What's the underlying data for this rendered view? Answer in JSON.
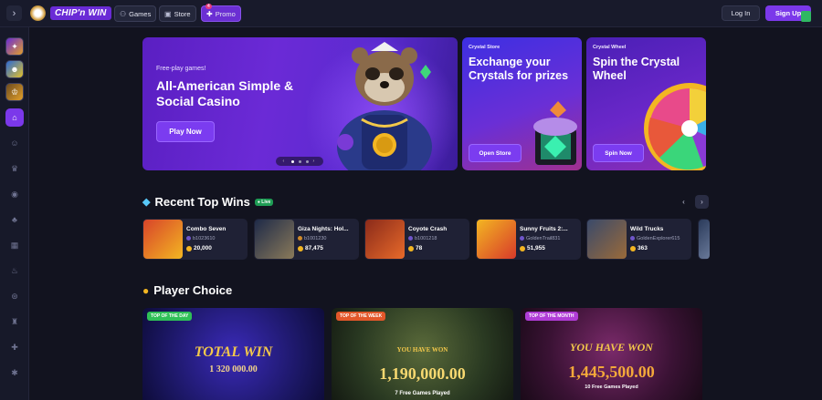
{
  "header": {
    "logo_text": "CHIP'n WIN",
    "nav": [
      {
        "label": "Games",
        "icon": "joystick-icon"
      },
      {
        "label": "Store",
        "icon": "store-icon"
      },
      {
        "label": "Promo",
        "icon": "gift-icon",
        "badge": "4"
      }
    ],
    "login_label": "Log In",
    "signup_label": "Sign Up"
  },
  "sidebar": {
    "items": [
      {
        "name": "slots-game-tile",
        "icon": "🎰"
      },
      {
        "name": "trophy-game-tile",
        "icon": "🏆"
      },
      {
        "name": "tournament-tile",
        "icon": "🏅"
      },
      {
        "name": "home",
        "icon": "⌂"
      },
      {
        "name": "users",
        "icon": "☺"
      },
      {
        "name": "crown",
        "icon": "♛"
      },
      {
        "name": "slots",
        "icon": "◉"
      },
      {
        "name": "cherries",
        "icon": "♣"
      },
      {
        "name": "table-games",
        "icon": "▦"
      },
      {
        "name": "fire",
        "icon": "♨"
      },
      {
        "name": "chip",
        "icon": "⊛"
      },
      {
        "name": "castle",
        "icon": "♜"
      },
      {
        "name": "gift",
        "icon": "✚"
      },
      {
        "name": "settings",
        "icon": "✱"
      }
    ]
  },
  "hero": {
    "eyebrow": "Free-play games!",
    "title": "All-American Simple & Social Casino",
    "cta": "Play Now"
  },
  "promos": [
    {
      "label": "Crystal Store",
      "title": "Exchange your Crystals for prizes",
      "cta": "Open Store"
    },
    {
      "label": "Crystal Wheel",
      "title": "Spin the Crystal Wheel",
      "cta": "Spin Now"
    }
  ],
  "recent_wins": {
    "title": "Recent Top Wins",
    "live": "Live",
    "items": [
      {
        "game": "Combo Seven",
        "user": "b1023610",
        "amount": "20,000",
        "color": "#c1372a"
      },
      {
        "game": "Giza Nights: Hol...",
        "user": "b1001230",
        "amount": "87,475",
        "color": "#2b3550"
      },
      {
        "game": "Coyote Crash",
        "user": "b1001218",
        "amount": "78",
        "color": "#b4331f"
      },
      {
        "game": "Sunny Fruits 2:...",
        "user": "GoldenTrail831",
        "amount": "51,955",
        "color": "#e0a120"
      },
      {
        "game": "Wild Trucks",
        "user": "GoldenExplorer615",
        "amount": "363",
        "color": "#4a5468"
      }
    ]
  },
  "player_choice": {
    "title": "Player Choice",
    "cards": [
      {
        "badge": "TOP OF THE DAY",
        "badge_color": "#2fbf57",
        "amount": "1 320 000.00",
        "headline": "TOTAL WIN",
        "sub": ""
      },
      {
        "badge": "TOP OF THE WEEK",
        "badge_color": "#e3572a",
        "amount": "1,190,000.00",
        "headline": "YOU HAVE WON",
        "sub": "7 Free Games Played"
      },
      {
        "badge": "TOP OF THE MONTH",
        "badge_color": "#b03cd6",
        "amount": "1,445,500.00",
        "headline": "YOU HAVE WON",
        "sub": "10 Free Games Played"
      }
    ]
  }
}
